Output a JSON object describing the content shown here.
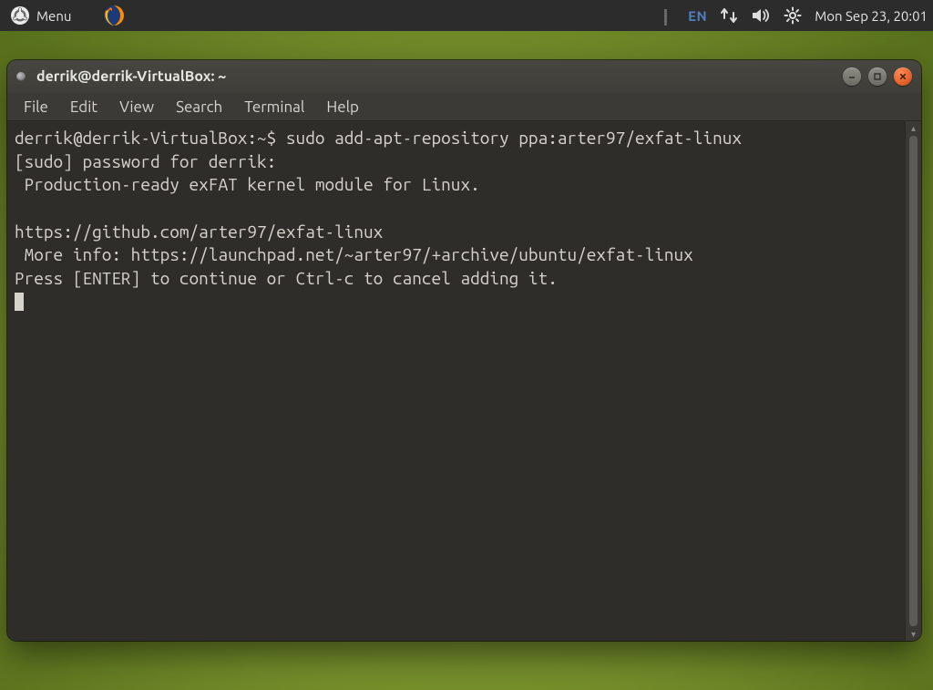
{
  "panel": {
    "menu_label": "Menu",
    "lang": "EN",
    "datetime": "Mon Sep 23, 20:01"
  },
  "window": {
    "title": "derrik@derrik-VirtualBox: ~",
    "menubar": [
      "File",
      "Edit",
      "View",
      "Search",
      "Terminal",
      "Help"
    ]
  },
  "terminal": {
    "prompt": "derrik@derrik-VirtualBox:~$ ",
    "command": "sudo add-apt-repository ppa:arter97/exfat-linux",
    "lines": [
      "[sudo] password for derrik:",
      " Production-ready exFAT kernel module for Linux.",
      "",
      "https://github.com/arter97/exfat-linux",
      " More info: https://launchpad.net/~arter97/+archive/ubuntu/exfat-linux",
      "Press [ENTER] to continue or Ctrl-c to cancel adding it."
    ]
  },
  "scroll": {
    "thumb_top_pct": 0,
    "thumb_height_pct": 100
  }
}
